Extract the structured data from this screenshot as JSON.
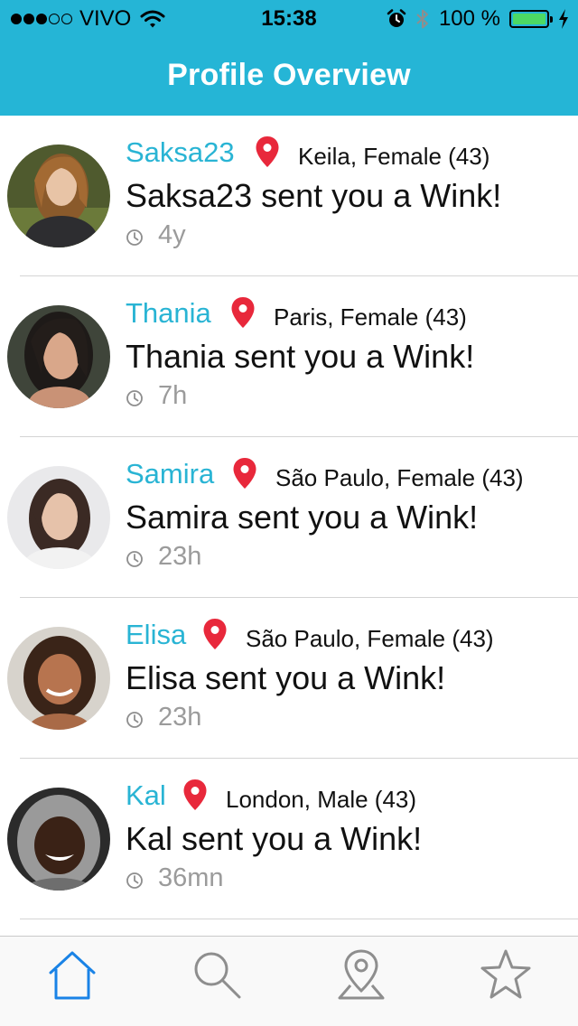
{
  "status_bar": {
    "carrier": "VIVO",
    "time": "15:38",
    "battery": "100 %",
    "signal_bars_filled": 3,
    "signal_bars_total": 5
  },
  "header": {
    "title": "Profile Overview",
    "background_color": "#25b5d6"
  },
  "accent_color": "#29b4d4",
  "pin_color": "#e8283b",
  "active_tab_color": "#1a83e6",
  "items": [
    {
      "name": "Saksa23",
      "location": "Keila, Female (43)",
      "message": "Saksa23 sent you a Wink!",
      "time": "4y"
    },
    {
      "name": "Thania",
      "location": "Paris, Female (43)",
      "message": "Thania sent you a Wink!",
      "time": "7h"
    },
    {
      "name": "Samira",
      "location": "São Paulo, Female (43)",
      "message": "Samira sent you a Wink!",
      "time": "23h"
    },
    {
      "name": "Elisa",
      "location": "São Paulo, Female (43)",
      "message": "Elisa sent you a Wink!",
      "time": "23h"
    },
    {
      "name": "Kal",
      "location": "London, Male (43)",
      "message": "Kal sent you a Wink!",
      "time": "36mn"
    }
  ],
  "tabs": [
    {
      "icon": "home-icon",
      "active": true
    },
    {
      "icon": "search-icon",
      "active": false
    },
    {
      "icon": "map-pin-icon",
      "active": false
    },
    {
      "icon": "star-icon",
      "active": false
    }
  ]
}
